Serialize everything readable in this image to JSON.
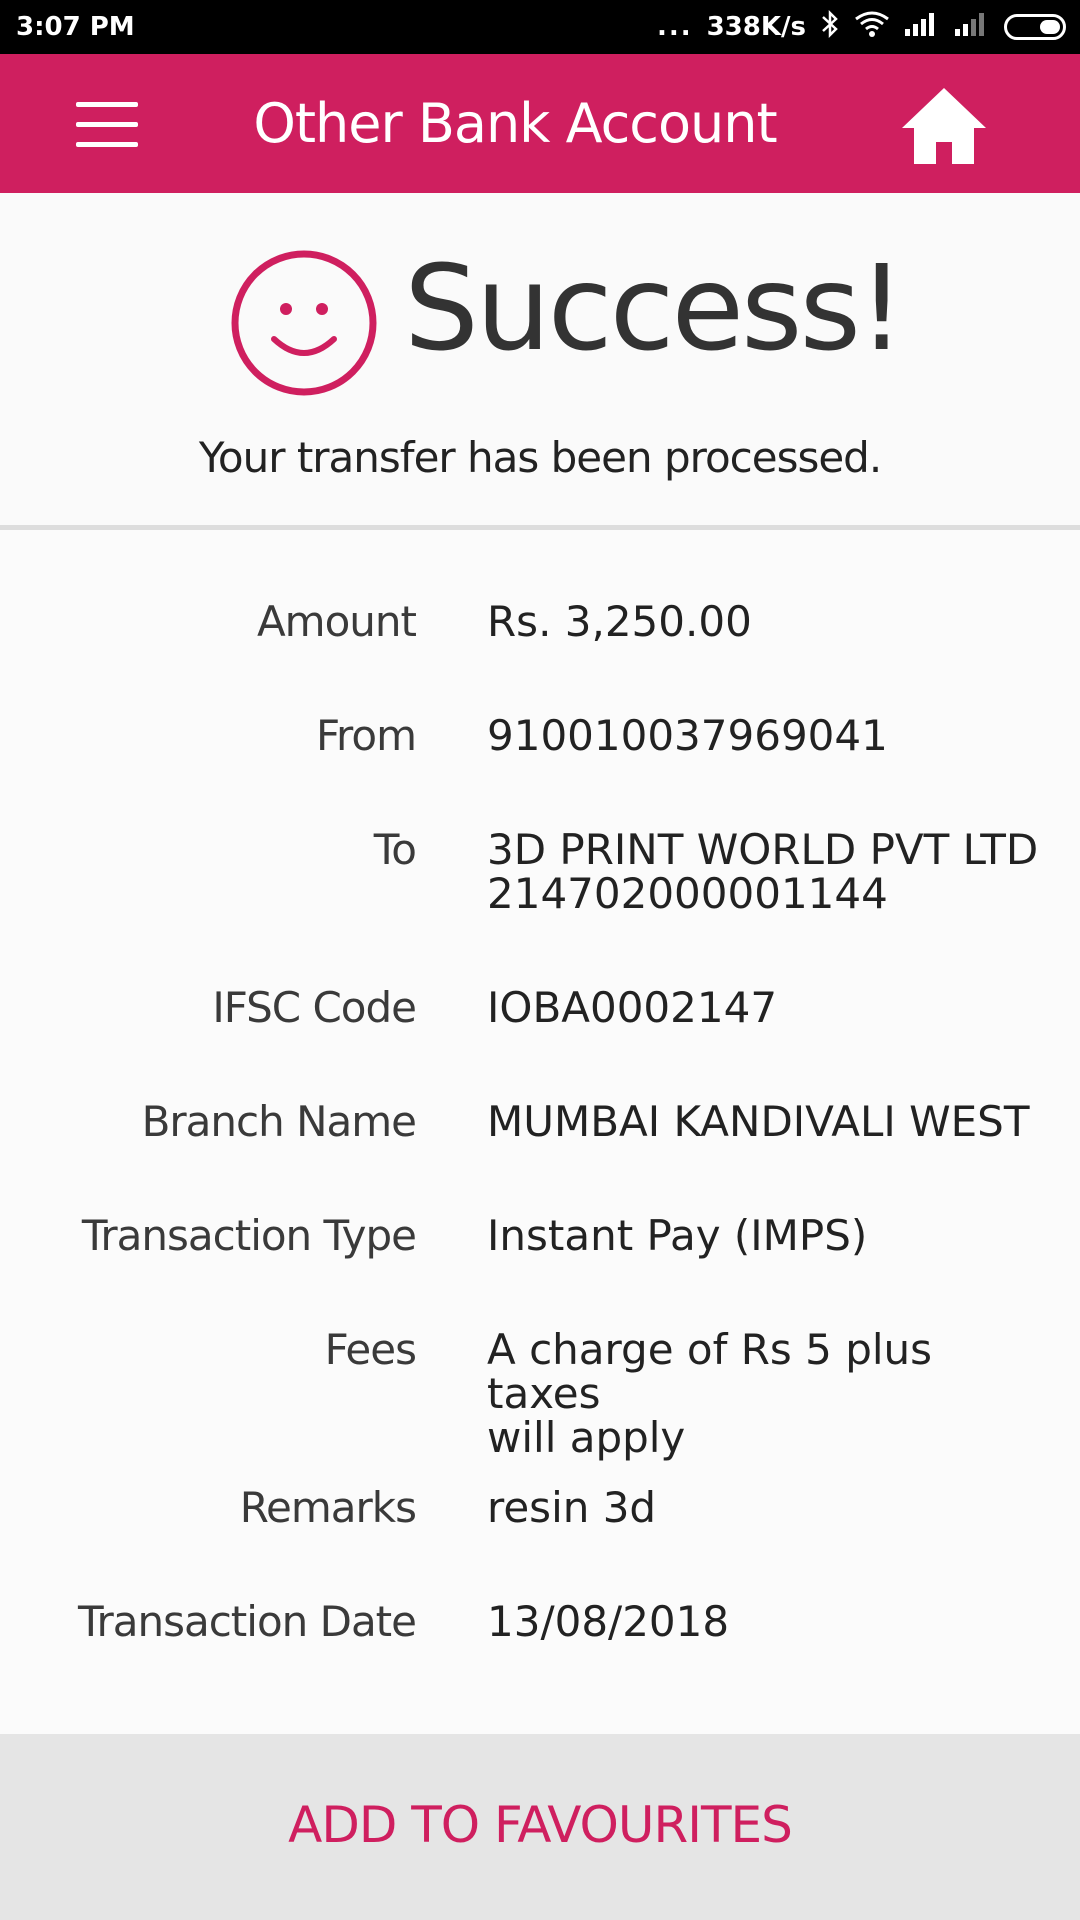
{
  "status_bar": {
    "time": "3:07 PM",
    "dots": "...",
    "network_speed": "338K/s",
    "icons": [
      "bluetooth-icon",
      "wifi-icon",
      "signal-icon",
      "signal-weak-icon",
      "battery-icon"
    ]
  },
  "header": {
    "title": "Other Bank Account",
    "menu_icon": "hamburger-menu-icon",
    "home_icon": "home-icon",
    "background_color": "#cf1f5f"
  },
  "success": {
    "icon": "smiley-icon",
    "title": "Success!",
    "message": "Your transfer has been processed."
  },
  "details": [
    {
      "label": "Amount",
      "value_lines": [
        "Rs. 3,250.00"
      ]
    },
    {
      "label": "From",
      "value_lines": [
        "910010037969041"
      ]
    },
    {
      "label": "To",
      "value_lines": [
        "3D PRINT WORLD PVT LTD",
        "214702000001144"
      ]
    },
    {
      "label": "IFSC Code",
      "value_lines": [
        "IOBA0002147"
      ]
    },
    {
      "label": "Branch Name",
      "value_lines": [
        "MUMBAI KANDIVALI WEST"
      ]
    },
    {
      "label": "Transaction Type",
      "value_lines": [
        "Instant Pay (IMPS)"
      ]
    },
    {
      "label": "Fees",
      "value_lines": [
        "A charge of Rs 5 plus taxes",
        "will apply"
      ]
    },
    {
      "label": "Remarks",
      "value_lines": [
        "resin 3d"
      ]
    },
    {
      "label": "Transaction Date",
      "value_lines": [
        "13/08/2018"
      ]
    }
  ],
  "footer": {
    "button_label": "ADD TO FAVOURITES",
    "accent_color": "#cf1f5f"
  }
}
